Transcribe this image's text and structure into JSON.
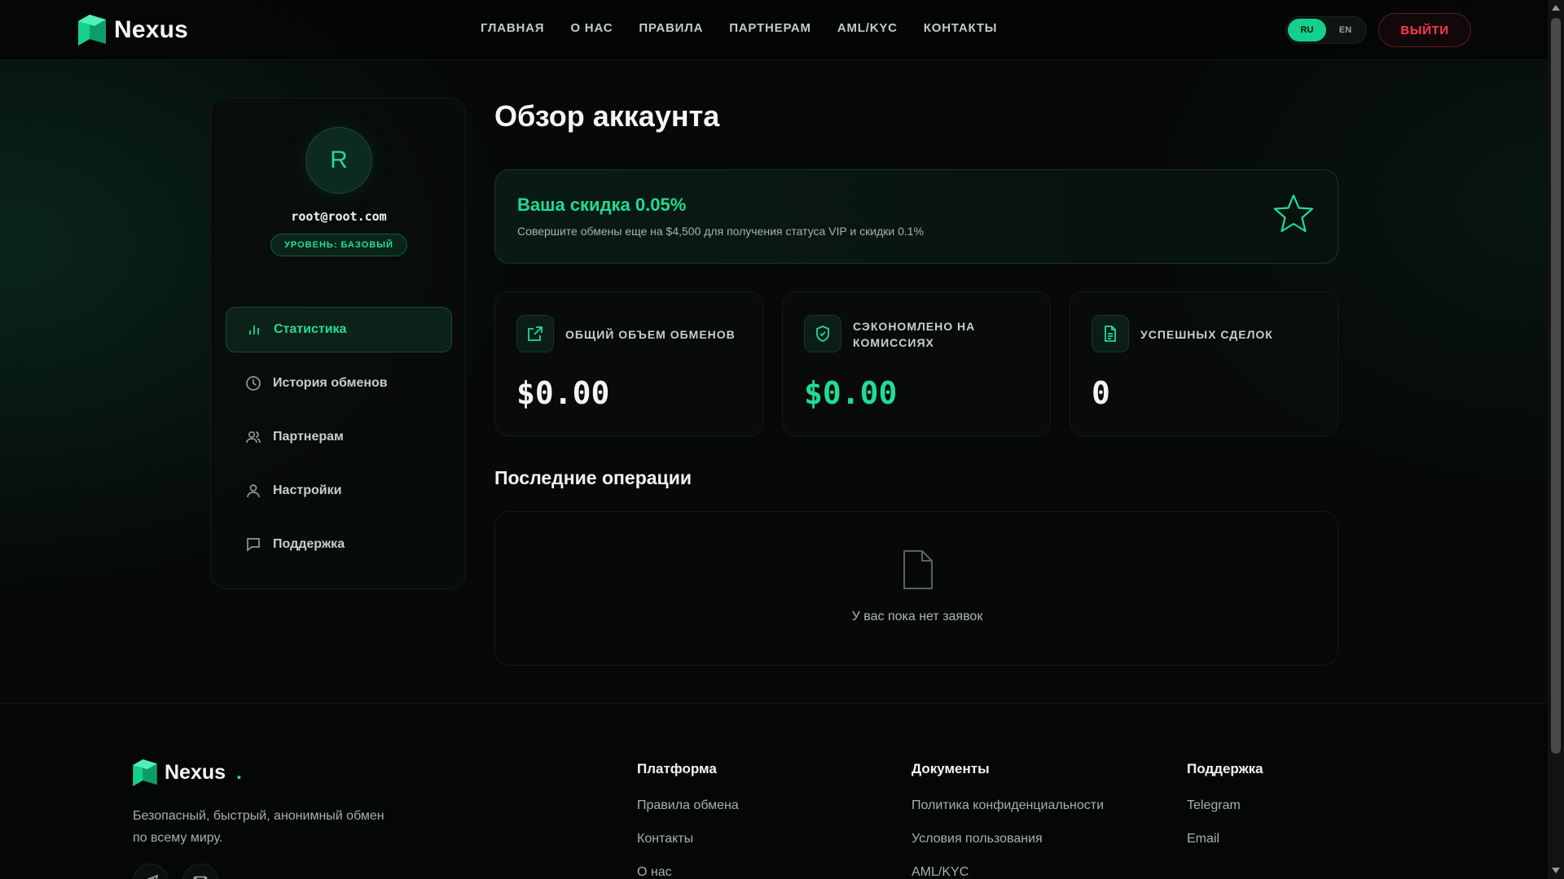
{
  "brand": {
    "name": "Nexus",
    "accent": "#13d08c",
    "danger": "#ff3b4a"
  },
  "nav": {
    "items": [
      "ГЛАВНАЯ",
      "О НАС",
      "ПРАВИЛА",
      "ПАРТНЕРАМ",
      "AML/KYC",
      "КОНТАКТЫ"
    ]
  },
  "lang": {
    "ru": "RU",
    "en": "EN",
    "active": "RU"
  },
  "header": {
    "logout_label": "ВЫЙТИ"
  },
  "profile": {
    "avatar_letter": "R",
    "email": "root@root.com",
    "level": "УРОВЕНЬ: БАЗОВЫЙ"
  },
  "sidebar": {
    "items": [
      {
        "label": "Статистика",
        "icon": "bar-chart-icon",
        "active": true
      },
      {
        "label": "История обменов",
        "icon": "clock-icon"
      },
      {
        "label": "Партнерам",
        "icon": "users-icon"
      },
      {
        "label": "Настройки",
        "icon": "user-icon"
      },
      {
        "label": "Поддержка",
        "icon": "chat-icon"
      }
    ]
  },
  "main": {
    "title": "Обзор аккаунта",
    "promo": {
      "title": "Ваша скидка 0.05%",
      "subtitle": "Совершите обмены еще на $4,500 для получения статуса VIP и скидки 0.1%",
      "icon": "star-icon"
    },
    "stats": [
      {
        "label": "ОБЩИЙ ОБЪЕМ ОБМЕНОВ",
        "value": "$0.00",
        "icon": "external-link-icon"
      },
      {
        "label": "СЭКОНОМЛЕНО НА КОМИССИЯХ",
        "value": "$0.00",
        "icon": "shield-check-icon"
      },
      {
        "label": "УСПЕШНЫХ СДЕЛОК",
        "value": "0",
        "icon": "document-icon"
      }
    ],
    "recent": {
      "title": "Последние операции",
      "empty_text": "У вас пока нет заявок",
      "icon": "file-icon"
    }
  },
  "footer": {
    "brand": "Nexus",
    "dot": ".",
    "description": "Безопасный, быстрый, анонимный обмен по всему миру.",
    "columns": [
      {
        "title": "Платформа",
        "links": [
          "Правила обмена",
          "Контакты",
          "О нас"
        ]
      },
      {
        "title": "Документы",
        "links": [
          "Политика конфиденциальности",
          "Условия пользования",
          "AML/KYC"
        ]
      },
      {
        "title": "Поддержка",
        "links": [
          "Telegram",
          "Email"
        ]
      }
    ]
  }
}
